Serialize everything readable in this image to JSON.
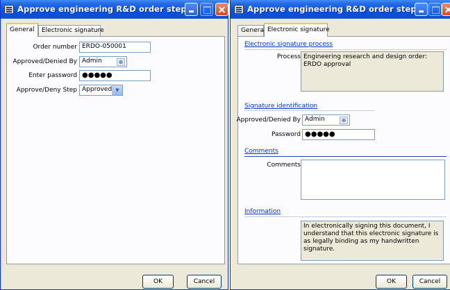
{
  "left": {
    "title": "Approve engineering R&D order step",
    "tabs": [
      "General",
      "Electronic signature"
    ],
    "fields": {
      "order_number_label": "Order number",
      "order_number_value": "ERDO-050001",
      "approved_by_label": "Approved/Denied By",
      "approved_by_value": "Admin",
      "password_label": "Enter password",
      "password_value": "●●●●●",
      "step_label": "Approve/Deny Step",
      "step_value": "Approved"
    },
    "buttons": {
      "ok": "OK",
      "cancel": "Cancel"
    }
  },
  "right": {
    "title": "Approve engineering R&D order step",
    "tabs": [
      "General",
      "Electronic signature"
    ],
    "sections": {
      "process_header": "Electronic signature process",
      "process_label": "Process",
      "process_value": "Engineering research and design order: ERDO approval",
      "sigid_header": "Signature identification",
      "approved_by_label": "Approved/Denied By",
      "approved_by_value": "Admin",
      "password_label": "Password",
      "password_value": "●●●●●",
      "comments_header": "Comments",
      "comments_label": "Comments",
      "comments_value": "",
      "info_header": "Information",
      "info_text": "In electronically signing this document, I understand that this electronic signature is as legally binding as my handwritten signature."
    },
    "buttons": {
      "ok": "OK",
      "cancel": "Cancel"
    }
  },
  "icons": [
    "window-icon",
    "minimize-icon",
    "maximize-icon",
    "close-icon",
    "lookup-icon",
    "dropdown-arrow-icon"
  ]
}
